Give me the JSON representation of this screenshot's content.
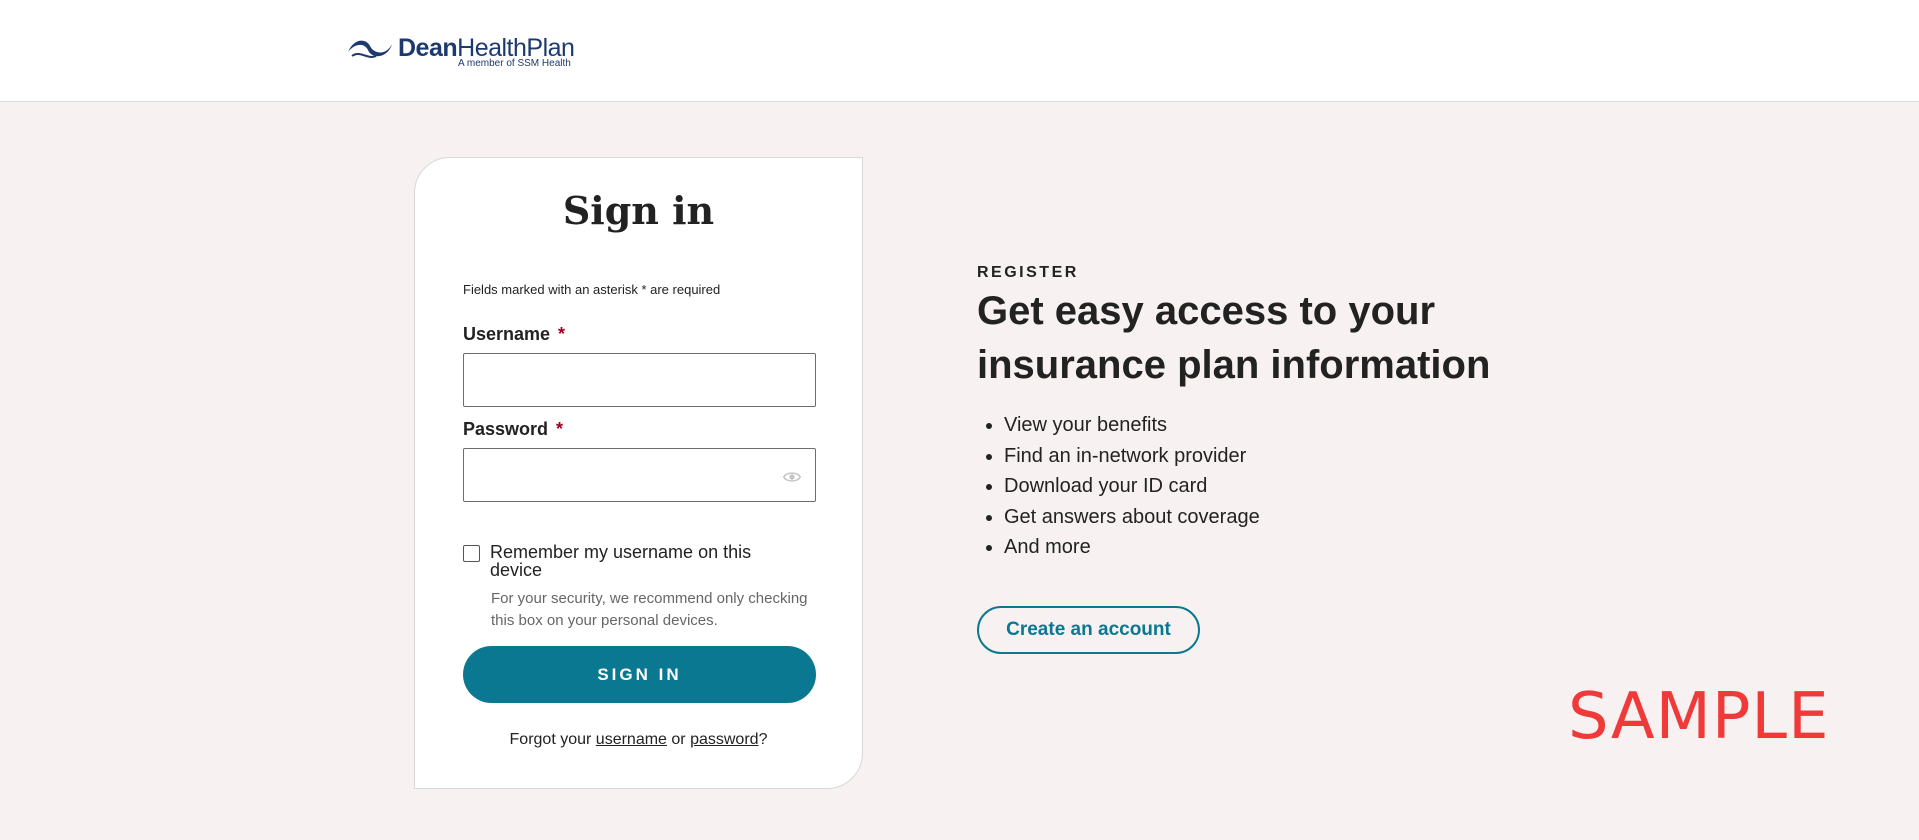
{
  "header": {
    "logo": {
      "brand_bold": "Dean",
      "brand_light": "HealthPlan",
      "tagline": "A member of SSM Health",
      "colors": {
        "primary": "#1c3a6e"
      }
    }
  },
  "signin": {
    "title": "Sign in",
    "required_note": "Fields marked with an asterisk * are required",
    "username": {
      "label": "Username",
      "required_mark": "*",
      "value": "",
      "placeholder": ""
    },
    "password": {
      "label": "Password",
      "required_mark": "*",
      "value": "",
      "placeholder": "",
      "toggle_icon": "eye-icon"
    },
    "remember": {
      "label": "Remember my username on this device",
      "checked": false
    },
    "security_hint": "For your security, we recommend only checking this box on your personal devices.",
    "submit_label": "SIGN IN",
    "forgot": {
      "prefix": "Forgot your ",
      "username_link": "username",
      "middle": " or ",
      "password_link": "password",
      "suffix": "?"
    }
  },
  "register": {
    "eyebrow": "REGISTER",
    "heading": "Get easy access to your insurance plan information",
    "benefits": [
      "View your benefits",
      "Find an in-network provider",
      "Download your ID card",
      "Get answers about coverage",
      "And more"
    ],
    "cta_label": "Create an account"
  },
  "watermark": "SAMPLE",
  "colors": {
    "accent": "#0b7891",
    "required": "#a3001b",
    "page_bg": "#f7f1f1",
    "watermark": "#f03a3a"
  }
}
